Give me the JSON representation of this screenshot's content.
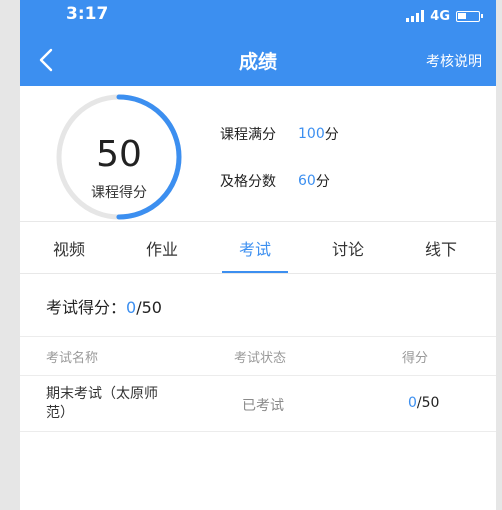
{
  "status_bar": {
    "time": "3:17",
    "network": "4G"
  },
  "nav": {
    "title": "成绩",
    "action": "考核说明"
  },
  "score": {
    "value": "50",
    "label": "课程得分",
    "progress_fraction": 0.5,
    "full_label": "课程满分",
    "full_value": "100",
    "full_unit": "分",
    "pass_label": "及格分数",
    "pass_value": "60",
    "pass_unit": "分"
  },
  "tabs": [
    {
      "label": "视频"
    },
    {
      "label": "作业"
    },
    {
      "label": "考试",
      "active": true
    },
    {
      "label": "讨论"
    },
    {
      "label": "线下"
    }
  ],
  "exam": {
    "score_label": "考试得分：",
    "score_current": "0",
    "score_total": "/50",
    "columns": [
      "考试名称",
      "考试状态",
      "得分"
    ],
    "rows": [
      {
        "name": "期末考试（太原师范）",
        "status": "已考试",
        "score_current": "0",
        "score_total": "/50"
      }
    ]
  },
  "colors": {
    "accent": "#3c8ff0",
    "track": "#e6e6e6"
  },
  "icons": {
    "back": "chevron-left-icon",
    "signal": "signal-icon",
    "battery": "battery-icon"
  }
}
